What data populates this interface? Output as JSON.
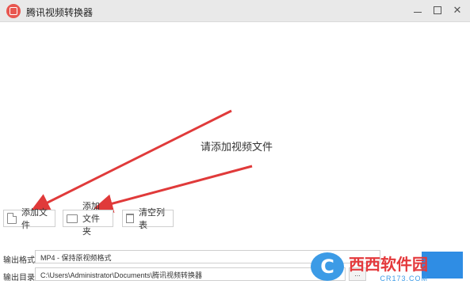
{
  "window": {
    "title": "腾讯视频转换器",
    "icon": "tencent-video-icon",
    "controls": [
      "minimize-icon",
      "maximize-icon",
      "close-icon"
    ]
  },
  "drop_area": {
    "prompt": "请添加视频文件"
  },
  "toolbar": {
    "add_file_label": "添加文件",
    "add_folder_label": "添加文件夹",
    "clear_list_label": "清空列表"
  },
  "output": {
    "format_label": "输出格式:",
    "format_value": "MP4 - 保持原视频格式",
    "dir_label": "输出目录:",
    "dir_value": "C:\\Users\\Administrator\\Documents\\腾讯视频转换器",
    "browse_label": "..."
  },
  "watermark": {
    "logo_glyph": "C",
    "name": "西西软件园",
    "sub": "CR173.COM"
  },
  "colors": {
    "titlebar": "#e9e9e9",
    "arrow": "#e03a3a",
    "accent": "#2f8de4"
  }
}
